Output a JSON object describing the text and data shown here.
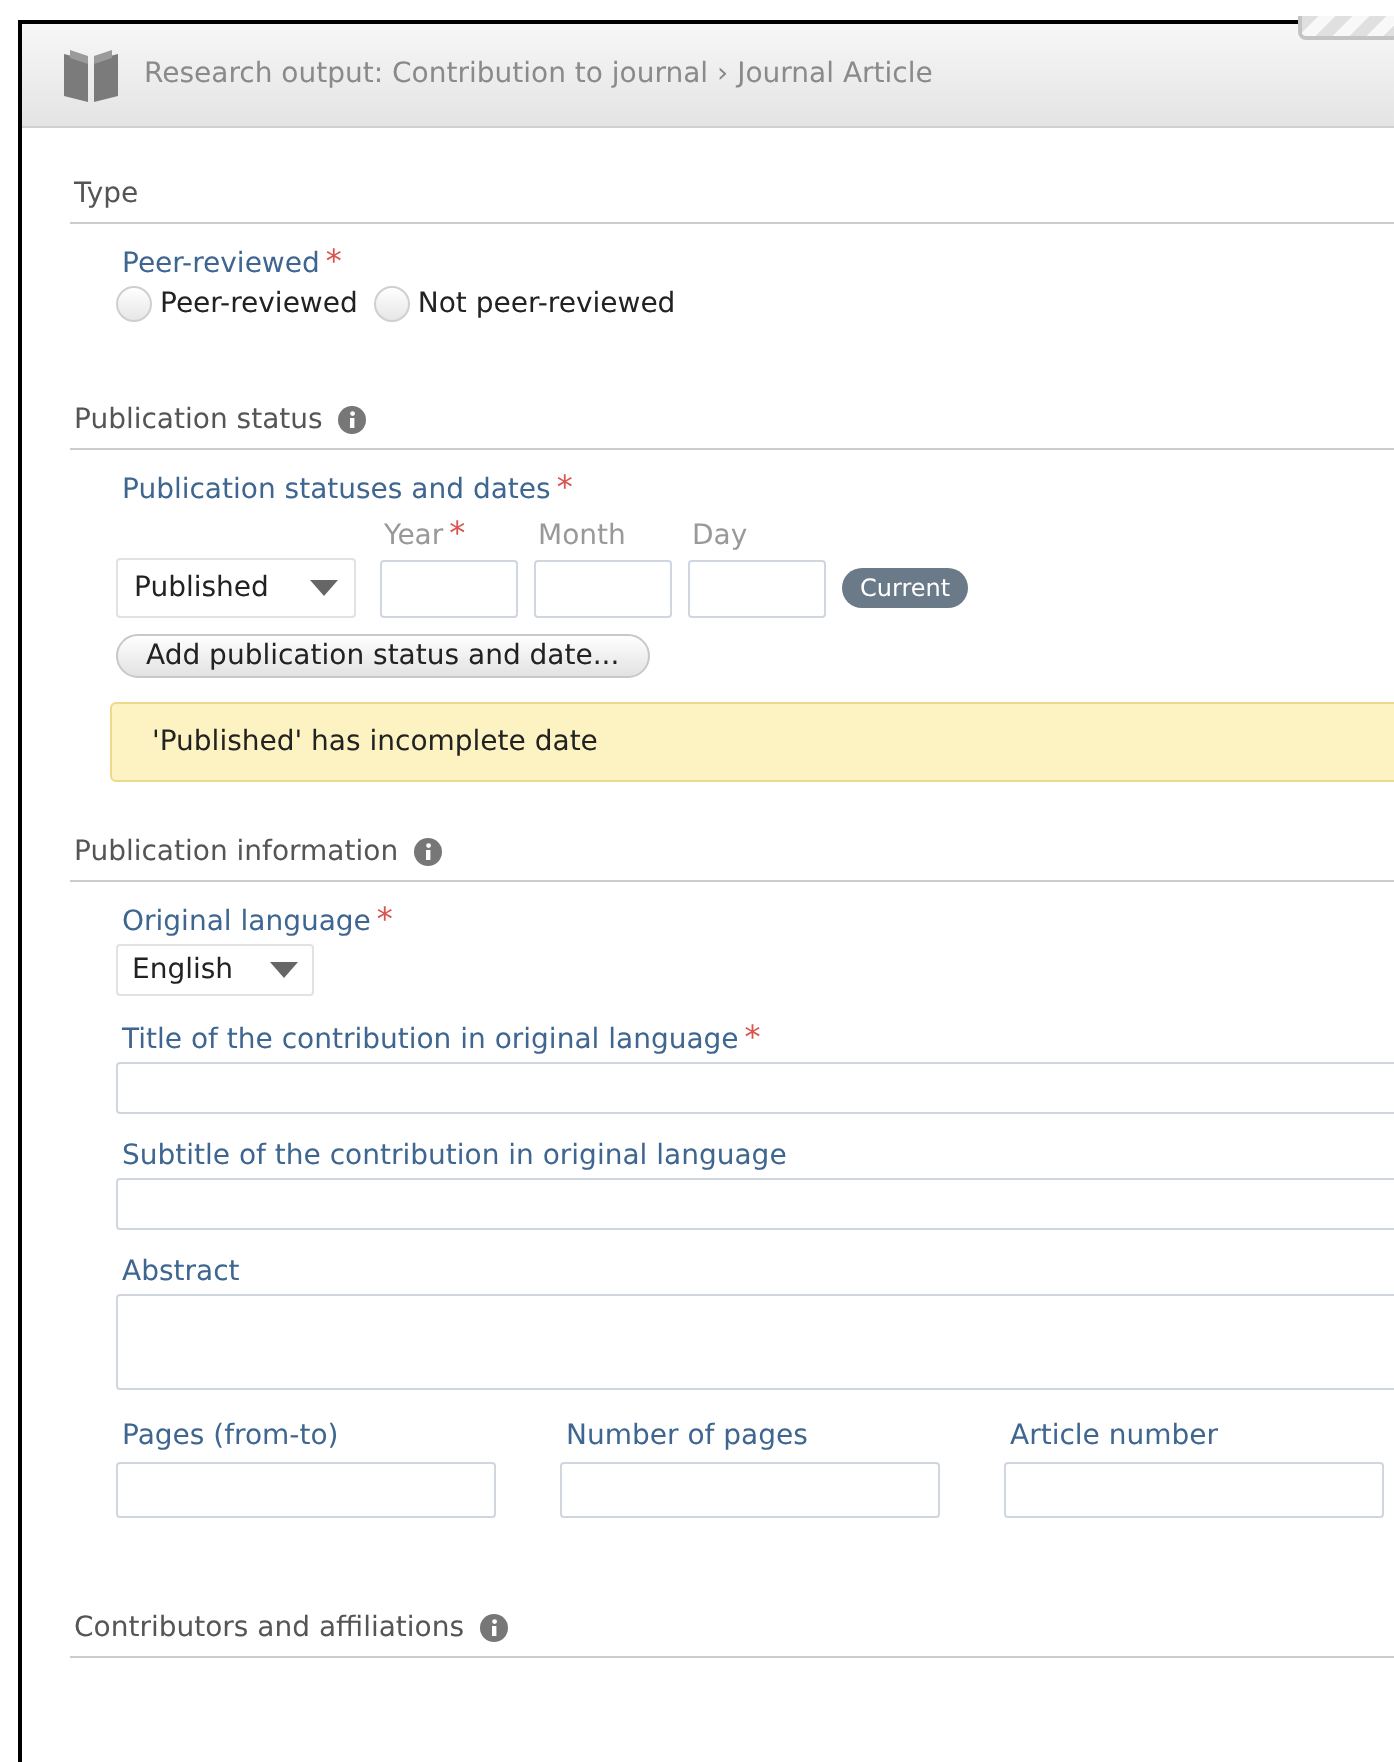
{
  "header": {
    "breadcrumb": "Research output: Contribution to journal › Journal Article"
  },
  "sections": [
    {
      "title": "Type",
      "info": false,
      "fields": [
        {
          "kind": "radio",
          "label": "Peer-reviewed",
          "required_mark": "*",
          "options": [
            {
              "label": "Peer-reviewed",
              "selected": false
            },
            {
              "label": "Not peer-reviewed",
              "selected": false
            }
          ]
        }
      ]
    },
    {
      "title": "Publication status",
      "info": true,
      "fields": [
        {
          "kind": "status",
          "label": "Publication statuses and dates",
          "required_mark": "*",
          "status": "Published",
          "date_parts": [
            {
              "label": "Year",
              "required_mark": "*"
            },
            {
              "label": "Month"
            },
            {
              "label": "Day"
            }
          ],
          "badge": "Current",
          "add_button": "Add publication status and date...",
          "warning": "'Published' has incomplete date"
        }
      ]
    },
    {
      "title": "Publication information",
      "info": true,
      "fields": [
        {
          "kind": "select",
          "label": "Original language",
          "required_mark": "*",
          "value": "English"
        },
        {
          "kind": "text",
          "label": "Title of the contribution in original language",
          "required_mark": "*"
        },
        {
          "kind": "text",
          "label": "Subtitle of the contribution in original language"
        },
        {
          "kind": "textarea",
          "label": "Abstract"
        },
        {
          "kind": "columns",
          "items": [
            {
              "label": "Pages (from-to)"
            },
            {
              "label": "Number of pages"
            },
            {
              "label": "Article number"
            }
          ]
        }
      ]
    },
    {
      "title": "Contributors and affiliations",
      "info": true
    }
  ]
}
